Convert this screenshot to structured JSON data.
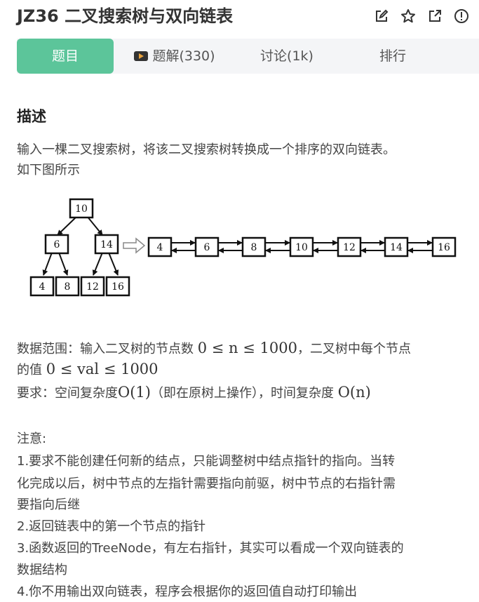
{
  "header": {
    "title": "JZ36  二叉搜索树与双向链表"
  },
  "tabs": [
    {
      "label": "题目"
    },
    {
      "label": "题解(330)"
    },
    {
      "label": "讨论(1k)"
    },
    {
      "label": "排行"
    }
  ],
  "section_title": "描述",
  "description": {
    "line1": "输入一棵二叉搜索树，将该二叉搜索树转换成一个排序的双向链表。",
    "line2": "如下图所示"
  },
  "figure": {
    "tree": [
      "10",
      "6",
      "14",
      "4",
      "8",
      "12",
      "16"
    ],
    "list": [
      "4",
      "6",
      "8",
      "10",
      "12",
      "14",
      "16"
    ]
  },
  "constraints": {
    "range_prefix": "数据范围：输入二叉树的节点数",
    "range_math": "0 ≤ n ≤ 1000",
    "range_mid": "，二叉树中每个节点",
    "val_prefix": "的值",
    "val_math": "0 ≤ val ≤ 1000",
    "req_prefix": "要求：空间复杂度",
    "space": "O(1)",
    "req_mid": "（即在原树上操作），时间复杂度",
    "time": "O(n)"
  },
  "notes": {
    "heading": "注意:",
    "lines": [
      "1.要求不能创建任何新的结点，只能调整树中结点指针的指向。当转",
      "化完成以后，树中节点的左指针需要指向前驱，树中节点的右指针需",
      "要指向后继",
      "2.返回链表中的第一个节点的指针",
      "3.函数返回的TreeNode，有左右指针，其实可以看成一个双向链表的",
      "数据结构",
      "4.你不用输出双向链表，程序会根据你的返回值自动打印输出"
    ]
  }
}
